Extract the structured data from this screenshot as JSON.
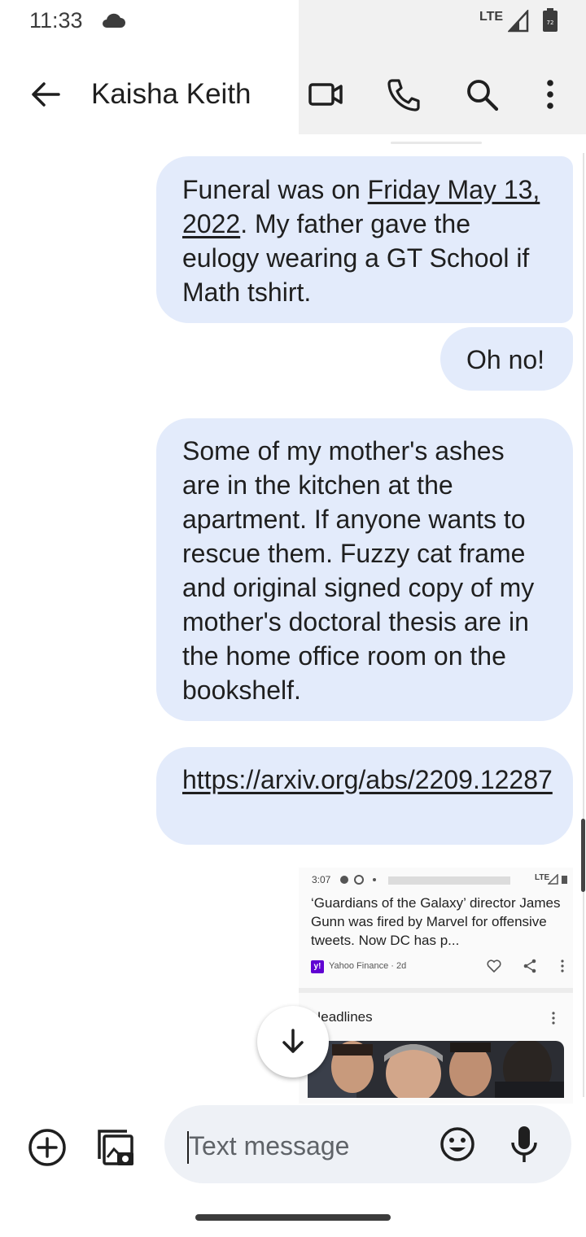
{
  "status_bar": {
    "time": "11:33",
    "network": "LTE",
    "battery": "72"
  },
  "header": {
    "contact_name": "Kaisha Keith"
  },
  "messages": [
    {
      "parts": [
        "Funeral was on ",
        "Friday May 13, 2022",
        ". My father gave the eulogy wearing a GT School if Math tshirt."
      ]
    },
    {
      "text": "Oh no!"
    },
    {
      "text": "Some of my mother's ashes are in the kitchen at the apartment. If anyone wants to rescue them. Fuzzy cat frame and original signed copy of my mother's doctoral thesis are in the home office room on the bookshelf."
    },
    {
      "link": "https://arxiv.org/abs/2209.12287"
    }
  ],
  "attachment": {
    "time": "3:07",
    "network": "LTE",
    "headline": "‘Guardians of the Galaxy’ director James Gunn was fired by Marvel for offensive tweets. Now DC has p...",
    "source": "Yahoo Finance · 2d",
    "yahoo_logo": "y!",
    "section_title": "Headlines"
  },
  "compose": {
    "placeholder": "Text message"
  },
  "colors": {
    "bubble": "#e3ebfb",
    "compose_field": "#eef1f6",
    "yahoo": "#6001d2"
  }
}
